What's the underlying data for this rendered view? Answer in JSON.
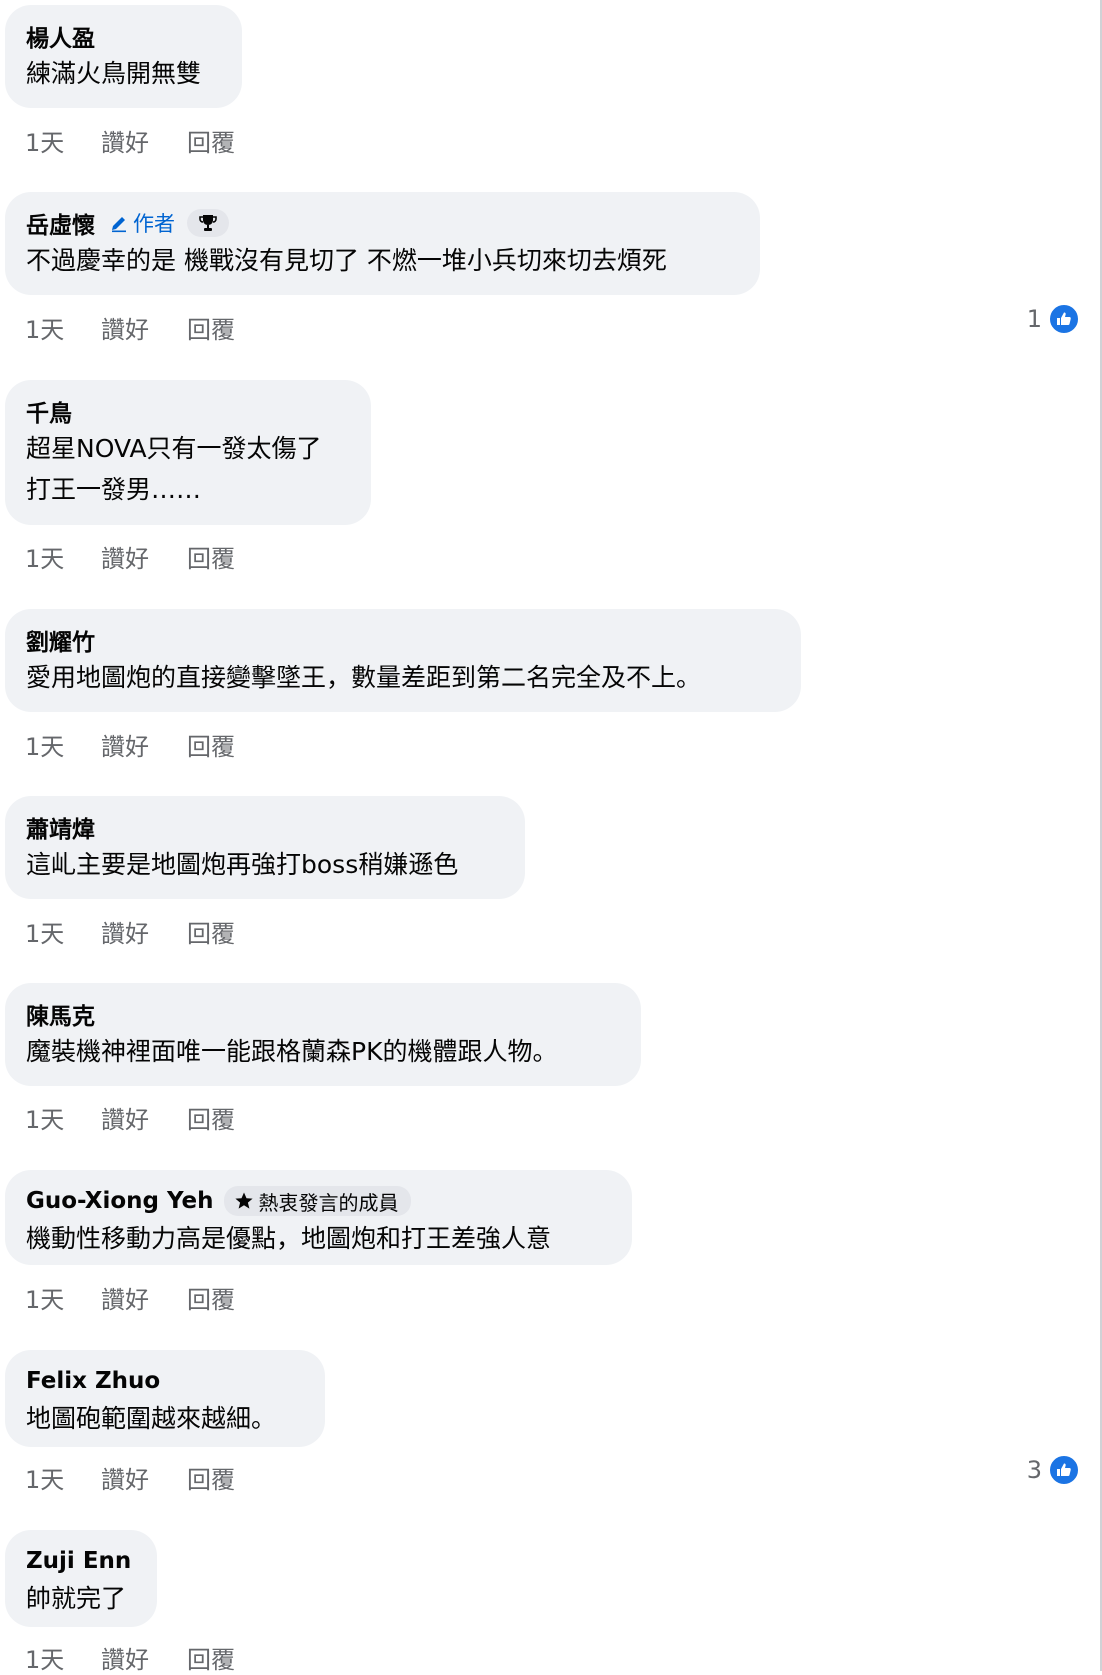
{
  "comments": [
    {
      "author": "楊人盈",
      "lines": [
        "練滿火鳥開無雙"
      ],
      "time": "1天",
      "like_label": "讚好",
      "reply_label": "回覆"
    },
    {
      "author": "岳虛懷",
      "author_badge": "作者",
      "lines": [
        "不過慶幸的是 機戰沒有見切了 不燃一堆小兵切來切去煩死"
      ],
      "time": "1天",
      "like_label": "讚好",
      "reply_label": "回覆",
      "reaction_count": "1"
    },
    {
      "author": "千鳥",
      "lines": [
        "超星NOVA只有一發太傷了",
        "打王一發男……"
      ],
      "time": "1天",
      "like_label": "讚好",
      "reply_label": "回覆"
    },
    {
      "author": "劉耀竹",
      "lines": [
        "愛用地圖炮的直接變擊墜王，數量差距到第二名完全及不上。"
      ],
      "time": "1天",
      "like_label": "讚好",
      "reply_label": "回覆"
    },
    {
      "author": "蕭靖煒",
      "lines": [
        "這乢主要是地圖炮再強打boss稍嫌遜色"
      ],
      "time": "1天",
      "like_label": "讚好",
      "reply_label": "回覆"
    },
    {
      "author": "陳馬克",
      "lines": [
        "魔裝機神裡面唯一能跟格蘭森PK的機體跟人物。"
      ],
      "time": "1天",
      "like_label": "讚好",
      "reply_label": "回覆"
    },
    {
      "author": "Guo-Xiong Yeh",
      "fan_badge": "熱衷發言的成員",
      "lines": [
        "機動性移動力高是優點，地圖炮和打王差強人意"
      ],
      "time": "1天",
      "like_label": "讚好",
      "reply_label": "回覆"
    },
    {
      "author": "Felix Zhuo",
      "lines": [
        "地圖砲範圍越來越細。"
      ],
      "time": "1天",
      "like_label": "讚好",
      "reply_label": "回覆",
      "reaction_count": "3"
    },
    {
      "author": "Zuji Enn",
      "lines": [
        "帥就完了"
      ],
      "time": "1天",
      "like_label": "讚好",
      "reply_label": "回覆"
    }
  ],
  "colors": {
    "bubble": "#f0f2f5",
    "secondary_text": "#65676b",
    "author_badge": "#0064d1",
    "like_reaction": "#1b74e4"
  },
  "icons": {
    "author_badge": "pencil-icon",
    "top_fan": "trophy-icon",
    "fan_badge": "star-icon",
    "reaction": "thumbs-up-icon"
  }
}
